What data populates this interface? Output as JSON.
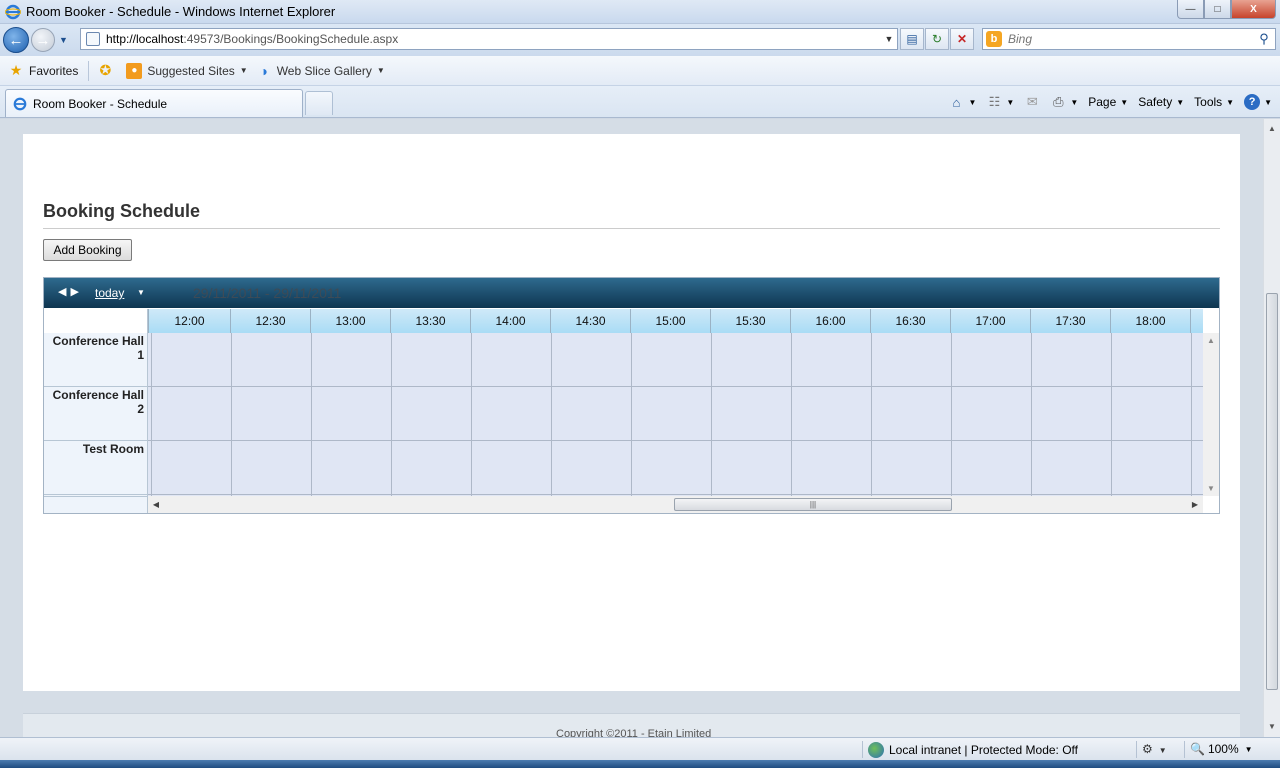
{
  "window": {
    "title": "Room Booker - Schedule - Windows Internet Explorer",
    "minimize": "—",
    "maximize": "□",
    "close": "X"
  },
  "address": {
    "url_host": "http://localhost",
    "url_rest": ":49573/Bookings/BookingSchedule.aspx",
    "search_placeholder": "Bing",
    "search_brand_letter": "b"
  },
  "favorites": {
    "favorites_label": "Favorites",
    "suggested_sites": "Suggested Sites",
    "web_slice_gallery": "Web Slice Gallery"
  },
  "tabs": [
    {
      "label": "Room Booker - Schedule"
    }
  ],
  "command_bar": {
    "page": "Page",
    "safety": "Safety",
    "tools": "Tools",
    "help": "?"
  },
  "page": {
    "heading": "Booking Schedule",
    "add_booking_button": "Add Booking",
    "footer_copyright": "Copyright ©2011 - Etain Limited"
  },
  "scheduler": {
    "today_label": "today",
    "date_range": "29/11/2011 - 29/11/2011",
    "times": [
      "12:00",
      "12:30",
      "13:00",
      "13:30",
      "14:00",
      "14:30",
      "15:00",
      "15:30",
      "16:00",
      "16:30",
      "17:00",
      "17:30",
      "18:00"
    ],
    "rooms": [
      "Conference Hall 1",
      "Conference Hall 2",
      "Test Room"
    ]
  },
  "status": {
    "zone_text": "Local intranet | Protected Mode: Off",
    "zoom": "100%"
  },
  "colors": {
    "scheduler_header": "#0e3550",
    "time_header": "#a9dcf5",
    "grid_cell": "#e0e6f4"
  }
}
